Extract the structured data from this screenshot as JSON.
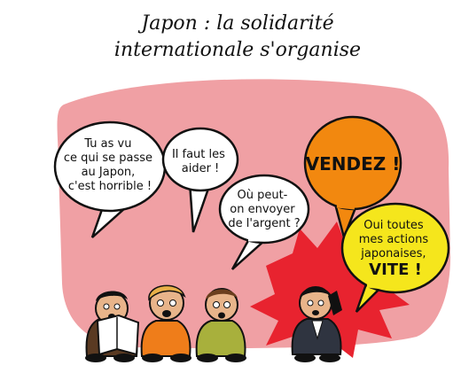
{
  "title": {
    "line1": "Japon : la solidarité",
    "line2": "internationale s'organise"
  },
  "bubbles": {
    "japon": [
      "Tu as vu",
      "ce qui se passe",
      "au Japon,",
      "c'est horrible !"
    ],
    "aider": [
      "Il faut les",
      "aider !"
    ],
    "argent": [
      "Où peut-",
      "on envoyer",
      "de l'argent ?"
    ],
    "vendez": [
      "VENDEZ !"
    ],
    "actions": [
      "Oui toutes",
      "mes actions",
      "japonaises,",
      "VITE !"
    ]
  },
  "colors": {
    "background_blob": "#f0a0a4",
    "burst": "#e8232f",
    "vendez_bubble": "#f2880f",
    "actions_bubble": "#f5e61c"
  }
}
